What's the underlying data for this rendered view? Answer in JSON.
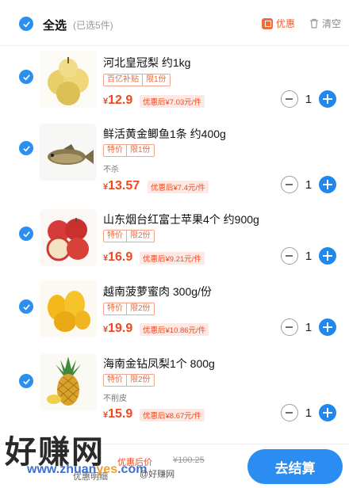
{
  "header": {
    "select_all": "全选",
    "selected_count": "(已选5件)",
    "discount": "优惠",
    "clear": "清空"
  },
  "items": [
    {
      "title": "河北皇冠梨 约1kg",
      "tags": [
        "百亿补贴",
        "限1份"
      ],
      "note": "",
      "yen": "¥",
      "price": "12.9",
      "after": "优惠后¥7.03元/件",
      "qty": "1"
    },
    {
      "title": "鲜活黄金鲫鱼1条 约400g",
      "tags": [
        "特价",
        "限1份"
      ],
      "note": "不杀",
      "yen": "¥",
      "price": "13.57",
      "after": "优惠后¥7.4元/件",
      "qty": "1"
    },
    {
      "title": "山东烟台红富士苹果4个 约900g",
      "tags": [
        "特价",
        "限2份"
      ],
      "note": "",
      "yen": "¥",
      "price": "16.9",
      "after": "优惠后¥9.21元/件",
      "qty": "1"
    },
    {
      "title": "越南菠萝蜜肉 300g/份",
      "tags": [
        "特价",
        "限2份"
      ],
      "note": "",
      "yen": "¥",
      "price": "19.9",
      "after": "优惠后¥10.86元/件",
      "qty": "1"
    },
    {
      "title": "海南金钻凤梨1个 800g",
      "tags": [
        "特价",
        "限2份"
      ],
      "note": "不削皮",
      "yen": "¥",
      "price": "15.9",
      "after": "优惠后¥8.67元/件",
      "qty": "1"
    }
  ],
  "bottom": {
    "discount_summary": "优惠后价",
    "original_total": "¥100.25",
    "detail": "优惠明细",
    "checkout": "去结算"
  },
  "watermark": {
    "brand": "好赚网",
    "url_a": "www.zhuan",
    "url_b": "yes",
    "url_c": ".com",
    "weibo": "@好赚网"
  }
}
